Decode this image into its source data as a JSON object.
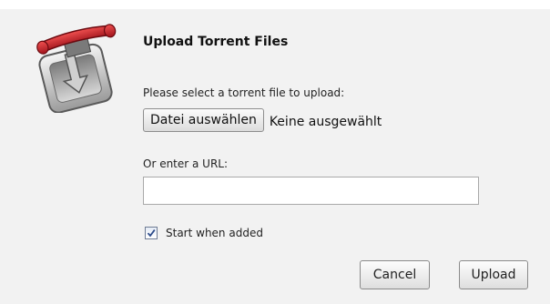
{
  "dialog": {
    "title": "Upload Torrent Files",
    "logo_icon": "transmission-logo-icon"
  },
  "file_picker": {
    "prompt": "Please select a torrent file to upload:",
    "button_label": "Datei auswählen",
    "status": "Keine ausgewählt"
  },
  "url": {
    "label": "Or enter a URL:",
    "value": "",
    "placeholder": ""
  },
  "start_option": {
    "label": "Start when added",
    "checked": true
  },
  "actions": {
    "cancel_label": "Cancel",
    "upload_label": "Upload"
  },
  "colors": {
    "dialog_background": "#f2f2f2",
    "logo_red": "#c8202a"
  }
}
